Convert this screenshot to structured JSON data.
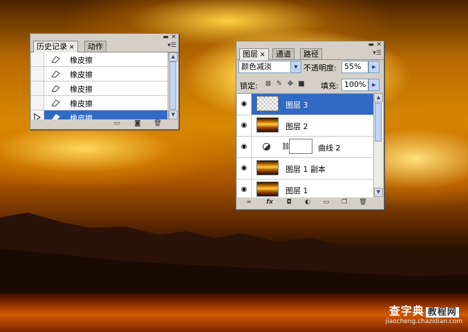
{
  "history_panel": {
    "tabs": [
      {
        "label": "历史记录",
        "active": true
      },
      {
        "label": "动作",
        "active": false
      }
    ],
    "items": [
      {
        "label": "橡皮擦",
        "selected": false
      },
      {
        "label": "橡皮擦",
        "selected": false
      },
      {
        "label": "橡皮擦",
        "selected": false
      },
      {
        "label": "橡皮擦",
        "selected": false
      },
      {
        "label": "橡皮擦",
        "selected": true
      }
    ]
  },
  "layers_panel": {
    "tabs": [
      {
        "label": "图层",
        "active": true
      },
      {
        "label": "通道",
        "active": false
      },
      {
        "label": "路径",
        "active": false
      }
    ],
    "blend_mode": "颜色减淡",
    "opacity_label": "不透明度:",
    "opacity_value": "55%",
    "lock_label": "锁定:",
    "fill_label": "填充:",
    "fill_value": "100%",
    "layers": [
      {
        "name": "图层 3",
        "selected": true,
        "thumb": "transparent"
      },
      {
        "name": "图层 2",
        "selected": false,
        "thumb": "sunset"
      },
      {
        "name": "曲线 2",
        "selected": false,
        "thumb": "white",
        "adjustment": true
      },
      {
        "name": "图层 1 副本",
        "selected": false,
        "thumb": "sunset"
      },
      {
        "name": "图层 1",
        "selected": false,
        "thumb": "sunset"
      }
    ]
  },
  "watermark": {
    "brand": "查字典",
    "box": "教程网",
    "url": "jiaocheng.chazidian.com"
  },
  "colors": {
    "selection": "#316ac5",
    "panel_bg": "#d4d0c8"
  }
}
